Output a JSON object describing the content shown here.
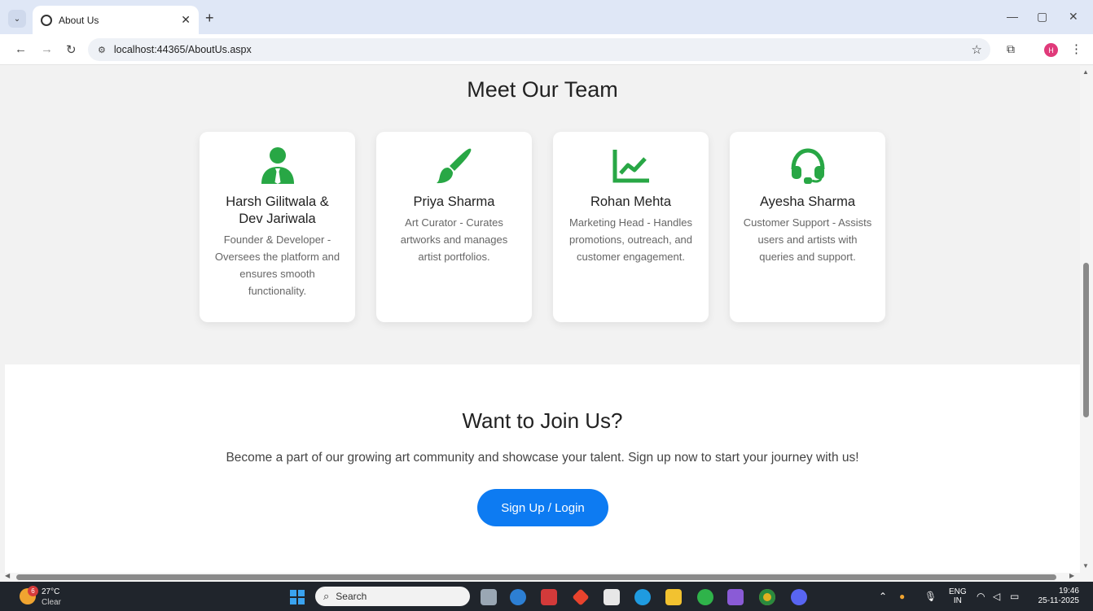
{
  "browser": {
    "tab_title": "About Us",
    "tab_close": "✕",
    "new_tab": "+",
    "url": "localhost:44365/AboutUs.aspx",
    "profile_initial": "H",
    "window_minimize": "—",
    "window_restore": "▢",
    "window_close": "✕"
  },
  "team": {
    "title": "Meet Our Team",
    "accent_color": "#28a745",
    "members": [
      {
        "name": "Harsh Gilitwala & Dev Jariwala",
        "role": "Founder & Developer - Oversees the platform and ensures smooth functionality.",
        "icon": "user-tie-icon"
      },
      {
        "name": "Priya Sharma",
        "role": "Art Curator - Curates artworks and manages artist portfolios.",
        "icon": "paint-brush-icon"
      },
      {
        "name": "Rohan Mehta",
        "role": "Marketing Head - Handles promotions, outreach, and customer engagement.",
        "icon": "line-chart-icon"
      },
      {
        "name": "Ayesha Sharma",
        "role": "Customer Support - Assists users and artists with queries and support.",
        "icon": "headset-icon"
      }
    ]
  },
  "join": {
    "title": "Want to Join Us?",
    "text": "Become a part of our growing art community and showcase your talent. Sign up now to start your journey with us!",
    "button_label": "Sign Up / Login",
    "button_color": "#0d7bf2"
  },
  "taskbar": {
    "weather_badge": "6",
    "temperature": "27°C",
    "condition": "Clear",
    "search_placeholder": "Search",
    "lang_top": "ENG",
    "lang_bottom": "IN",
    "time": "19:46",
    "date": "25-11-2025"
  }
}
